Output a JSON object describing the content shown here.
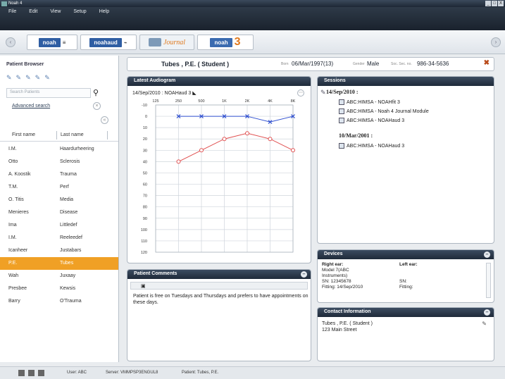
{
  "window": {
    "title": "Noah 4",
    "controls": [
      "_",
      "□",
      "X"
    ]
  },
  "menu": [
    "File",
    "Edit",
    "View",
    "Setup",
    "Help"
  ],
  "toolbar": {
    "back": "‹",
    "forward": "›",
    "modules": [
      {
        "logo": "noah",
        "suffix": "≡"
      },
      {
        "logo": "noahaud",
        "suffix": "⌁"
      },
      {
        "logo": "",
        "suffix": "Journal"
      },
      {
        "logo": "noah",
        "suffix": "3"
      }
    ]
  },
  "patient_browser": {
    "title": "Patient Browser",
    "icons": [
      "✎",
      "✎",
      "✎",
      "✎",
      "✎"
    ],
    "search_placeholder": "Search Patients",
    "advanced_search": "Advanced search",
    "columns": [
      "First name",
      "Last name"
    ],
    "patients": [
      {
        "first": "I.M.",
        "last": "Haardurheering"
      },
      {
        "first": "Otto",
        "last": "Sclerosis"
      },
      {
        "first": "A. Koostik",
        "last": "Trauma"
      },
      {
        "first": "T.M.",
        "last": "Perf"
      },
      {
        "first": "O. Titis",
        "last": "Media"
      },
      {
        "first": "Menieres",
        "last": "Disease"
      },
      {
        "first": "Ima",
        "last": "Littledef"
      },
      {
        "first": "I.M.",
        "last": "Reeleedef"
      },
      {
        "first": "Icanheer",
        "last": "Justabars"
      },
      {
        "first": "P.E.",
        "last": "Tubes"
      },
      {
        "first": "Wah",
        "last": "Juxaay"
      },
      {
        "first": "Presbee",
        "last": "Kewsis"
      },
      {
        "first": "Barry",
        "last": "O'Trauma"
      }
    ],
    "selected_index": 9
  },
  "patient_header": {
    "name": "Tubes , P.E. ( Student )",
    "born_label": "Born",
    "born": "06/Mar/1997(13)",
    "gender_label": "Gender",
    "gender": "Male",
    "ssn_label": "Soc. Sec. no.",
    "ssn": "986-34-5636",
    "close": "✖"
  },
  "audiogram": {
    "panel_title": "Latest Audiogram",
    "session_line": "14/Sep/2010 : NOAHaud 3",
    "colors": {
      "right": "#e05050",
      "left": "#3050d0",
      "grid": "#cfd5dc"
    }
  },
  "chart_data": {
    "type": "line",
    "title": "",
    "x": [
      "125",
      "250",
      "500",
      "1K",
      "2K",
      "4K",
      "8K"
    ],
    "xlabel": "",
    "ylabel": "",
    "ylim": [
      -10,
      120
    ],
    "y_ticks": [
      "-10",
      "0",
      "10",
      "20",
      "30",
      "40",
      "50",
      "60",
      "70",
      "80",
      "90",
      "100",
      "110",
      "120"
    ],
    "y_inverted": true,
    "series": [
      {
        "marker": "o",
        "color": "#e05050",
        "x": [
          "250",
          "500",
          "1K",
          "2K",
          "4K",
          "8K"
        ],
        "values": [
          40,
          30,
          20,
          15,
          20,
          30
        ]
      },
      {
        "marker": "x",
        "color": "#3050d0",
        "x": [
          "250",
          "500",
          "1K",
          "2K",
          "4K",
          "8K"
        ],
        "values": [
          0,
          0,
          0,
          0,
          5,
          0
        ]
      }
    ]
  },
  "sessions": {
    "title": "Sessions",
    "groups": [
      {
        "date": "14/Sep/2010 :",
        "items": [
          "ABC:HIMSA - NOAHfit 3",
          "ABC:HIMSA - Noah 4 Journal Module",
          "ABC:HIMSA - NOAHaud 3"
        ]
      },
      {
        "date": "10/Mar/2001 :",
        "items": [
          "ABC:HIMSA - NOAHaud 3"
        ]
      }
    ]
  },
  "comments": {
    "title": "Patient Comments",
    "text": "Patient is free on Tuesdays and Thursdays and prefers to have appointments on these days."
  },
  "devices": {
    "title": "Devices",
    "right_label": "Right ear:",
    "right_lines": [
      "Model 7(ABC",
      "Instruments)",
      "SN: 12345678",
      "Fitting: 14/Sep/2010"
    ],
    "left_label": "Left ear:",
    "left_lines": [
      "",
      "",
      "SN:",
      "Fitting:"
    ]
  },
  "contact": {
    "title": "Contact Information",
    "name": "Tubes , P.E. ( Student )",
    "address": "123 Main Street"
  },
  "status": {
    "user": "User: ABC",
    "server": "Server: VMMPSP3ENGUL8",
    "patient": "Patient: Tubes, P.E."
  }
}
